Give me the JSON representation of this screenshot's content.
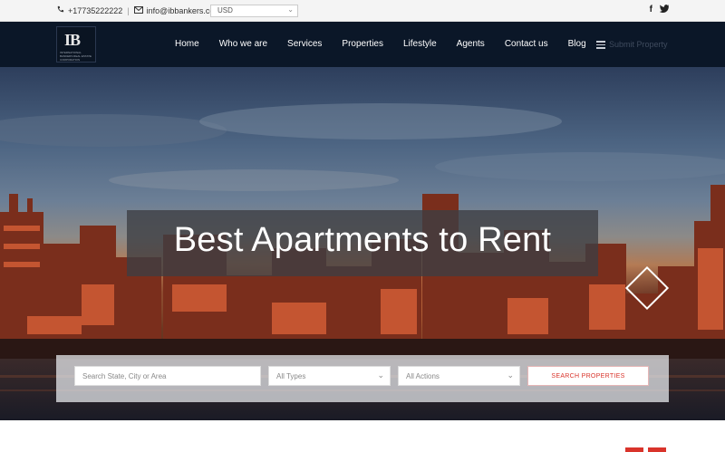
{
  "topbar": {
    "phone": "+17735222222",
    "separator": "|",
    "email": "info@ibbankers.com",
    "currency": {
      "selected": "USD"
    },
    "social": [
      "f",
      "twitter"
    ]
  },
  "header": {
    "logo": {
      "mark": "IB",
      "tagline": "INTERNATIONAL BANKERS REAL ESTATE CORPORATION"
    },
    "nav": [
      "Home",
      "Who we are",
      "Services",
      "Properties",
      "Lifestyle",
      "Agents",
      "Contact us",
      "Blog"
    ],
    "submit_label": "Submit Property"
  },
  "hero": {
    "headline": "Best Apartments to Rent"
  },
  "search": {
    "location_placeholder": "Search State, City or Area",
    "type_selected": "All Types",
    "action_selected": "All Actions",
    "button_label": "SEARCH PROPERTIES"
  },
  "colors": {
    "header_bg": "#0b1728",
    "accent": "#d9342b",
    "topbar_bg": "#f4f4f4"
  }
}
